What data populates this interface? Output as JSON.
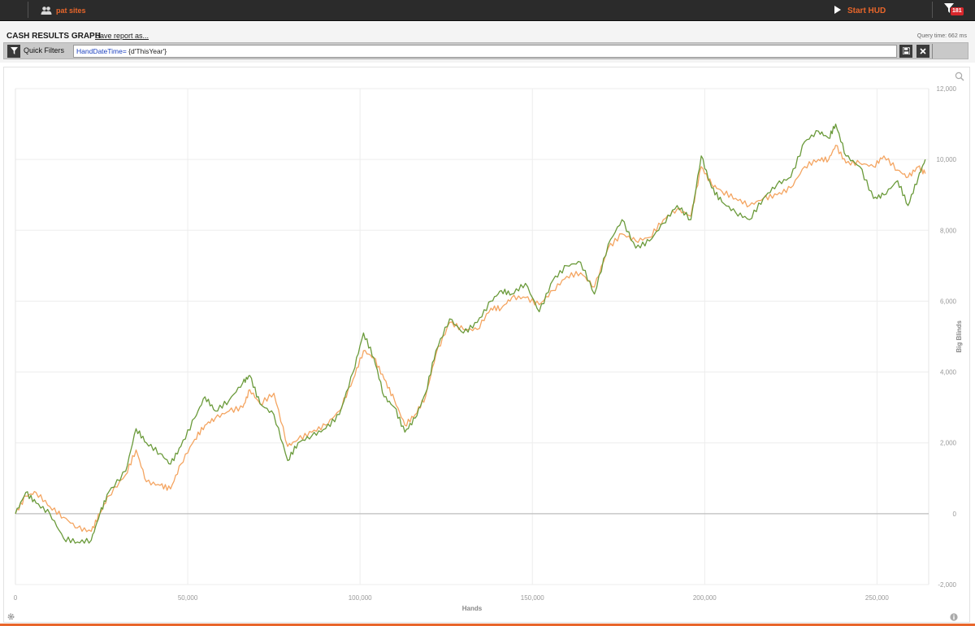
{
  "topbar": {
    "sites_label": "pat sites",
    "start_hud_label": "Start HUD",
    "notification_count": "181"
  },
  "header": {
    "title": "CASH RESULTS GRAPH",
    "save_report_label": "Save report as...",
    "query_time": "Query time: 662 ms"
  },
  "filter": {
    "label": "Quick Filters",
    "expression_key": "HandDateTime=",
    "expression_value": " {d'ThisYear'}"
  },
  "colors": {
    "accent": "#e8662b",
    "topbar_bg": "#2b2b2b",
    "series_green": "#6a9a3a",
    "series_orange": "#f4a460"
  },
  "chart_data": {
    "type": "line",
    "title": "",
    "xlabel": "Hands",
    "ylabel": "Big Blinds",
    "xlim": [
      0,
      265000
    ],
    "ylim": [
      -2000,
      12000
    ],
    "x_ticks": [
      0,
      50000,
      100000,
      150000,
      200000,
      250000
    ],
    "x_tick_labels": [
      "0",
      "50,000",
      "100,000",
      "150,000",
      "200,000",
      "250,000"
    ],
    "y_ticks": [
      -2000,
      0,
      2000,
      4000,
      6000,
      8000,
      10000,
      12000
    ],
    "y_tick_labels": [
      "-2,000",
      "0",
      "2,000",
      "4,000",
      "6,000",
      "8,000",
      "10,000",
      "12,000"
    ],
    "y_axis_side": "right",
    "grid": true,
    "series": [
      {
        "color": "#6a9a3a",
        "x": [
          0,
          3000,
          6000,
          10000,
          14000,
          18000,
          22000,
          24500,
          27000,
          32000,
          35000,
          38000,
          42000,
          45000,
          48000,
          52000,
          55000,
          58000,
          62000,
          66000,
          68000,
          71000,
          75000,
          79000,
          82000,
          86000,
          90000,
          94000,
          98000,
          101000,
          104000,
          107000,
          110000,
          113000,
          116000,
          119000,
          122000,
          126000,
          130000,
          134000,
          138000,
          141000,
          144000,
          148000,
          152000,
          156000,
          160000,
          164000,
          168000,
          172000,
          176000,
          180000,
          184000,
          188000,
          192000,
          196000,
          199000,
          202000,
          205000,
          209000,
          213000,
          217000,
          221000,
          225000,
          229000,
          233000,
          236000,
          238000,
          241000,
          245000,
          249000,
          252000,
          256000,
          259000,
          262000,
          264000
        ],
        "y": [
          0,
          600,
          300,
          0,
          -700,
          -800,
          -750,
          0,
          600,
          1200,
          2400,
          2000,
          1700,
          1400,
          1900,
          2700,
          3300,
          2900,
          3200,
          3700,
          3900,
          3100,
          2800,
          1500,
          2000,
          2200,
          2400,
          2800,
          4000,
          5100,
          4400,
          3300,
          3000,
          2300,
          2700,
          3400,
          4600,
          5500,
          5100,
          5400,
          6000,
          6300,
          6200,
          6500,
          5700,
          6600,
          7000,
          7100,
          6200,
          7600,
          8300,
          7500,
          7700,
          8200,
          8700,
          8300,
          10100,
          9200,
          8800,
          8500,
          8300,
          8900,
          9300,
          9500,
          10500,
          10800,
          10600,
          11000,
          10100,
          9800,
          8900,
          9000,
          9400,
          8700,
          9500,
          10000
        ]
      },
      {
        "color": "#f4a460",
        "x": [
          0,
          3000,
          6000,
          10000,
          14000,
          18000,
          22000,
          24500,
          27000,
          32000,
          35000,
          38000,
          42000,
          45000,
          48000,
          52000,
          55000,
          58000,
          62000,
          66000,
          68000,
          71000,
          75000,
          79000,
          82000,
          86000,
          90000,
          94000,
          98000,
          101000,
          104000,
          107000,
          110000,
          113000,
          116000,
          119000,
          122000,
          126000,
          130000,
          134000,
          138000,
          141000,
          144000,
          148000,
          152000,
          156000,
          160000,
          164000,
          168000,
          172000,
          176000,
          180000,
          184000,
          188000,
          192000,
          196000,
          199000,
          202000,
          205000,
          209000,
          213000,
          217000,
          221000,
          225000,
          229000,
          233000,
          236000,
          238000,
          241000,
          245000,
          249000,
          252000,
          256000,
          259000,
          262000,
          264000
        ],
        "y": [
          0,
          500,
          600,
          200,
          -100,
          -400,
          -500,
          0,
          500,
          1100,
          1800,
          900,
          800,
          700,
          1400,
          2100,
          2500,
          2700,
          2900,
          3000,
          3500,
          3100,
          3400,
          1900,
          2100,
          2300,
          2500,
          2900,
          3800,
          4600,
          4400,
          3800,
          3200,
          2500,
          2800,
          3300,
          4500,
          5400,
          5200,
          5200,
          5800,
          5800,
          6100,
          6100,
          5900,
          6300,
          6700,
          6800,
          6400,
          7500,
          7900,
          7700,
          7800,
          8300,
          8600,
          8400,
          9800,
          9300,
          9100,
          8900,
          8700,
          8900,
          9000,
          9200,
          9800,
          10000,
          10000,
          10400,
          9900,
          9900,
          9800,
          10100,
          9700,
          9500,
          9800,
          9600
        ]
      }
    ]
  }
}
